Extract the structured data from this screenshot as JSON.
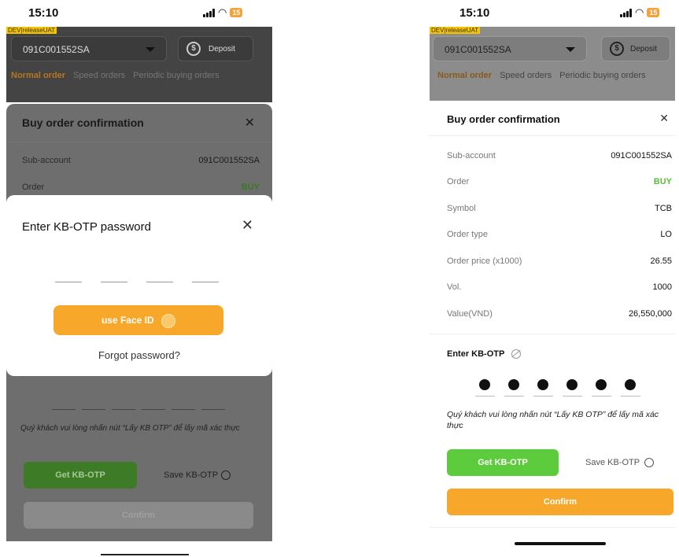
{
  "status": {
    "time": "15:10",
    "battery": "15"
  },
  "dev_tag": "DEV|releaseUAT",
  "account": {
    "number": "091C001552SA"
  },
  "deposit_label": "Deposit",
  "tabs": [
    "Normal order",
    "Speed orders",
    "Periodic buying orders"
  ],
  "confirm_sheet": {
    "title": "Buy order confirmation",
    "rows": [
      {
        "label": "Sub-account",
        "value": "091C001552SA"
      },
      {
        "label": "Order",
        "value": "BUY"
      },
      {
        "label": "Symbol",
        "value": "TCB"
      },
      {
        "label": "Order type",
        "value": "LO"
      },
      {
        "label": "Order price (x1000)",
        "value": "26.55"
      },
      {
        "label": "Vol.",
        "value": "1000"
      },
      {
        "label": "Value(VND)",
        "value": "26,550,000"
      }
    ]
  },
  "otp_modal": {
    "title": "Enter KB-OTP password",
    "face_id_label": "use Face ID",
    "forgot_label": "Forgot password?"
  },
  "otp_section": {
    "label": "Enter KB-OTP",
    "note": "Quý khách vui lòng nhấn nút “Lấy KB OTP” để lấy mã xác thực",
    "get_label": "Get KB-OTP",
    "save_label": "Save KB-OTP",
    "confirm_label": "Confirm"
  },
  "colors": {
    "accent_orange": "#f7a82a",
    "buy_green": "#5dbb3a",
    "get_otp_green": "#5dcc3c"
  }
}
